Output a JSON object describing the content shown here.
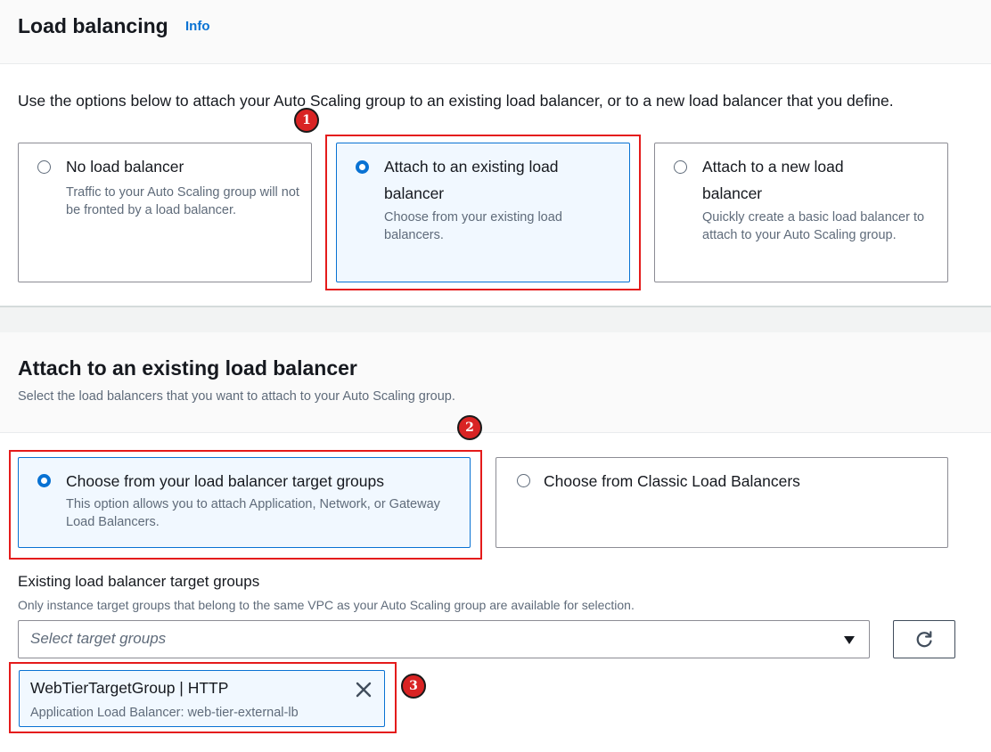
{
  "section1": {
    "title": "Load balancing",
    "info_link": "Info",
    "intro": "Use the options below to attach your Auto Scaling group to an existing load balancer, or to a new load balancer that you define."
  },
  "lb_options": [
    {
      "label": "No load balancer",
      "description": "Traffic to your Auto Scaling group will not be fronted by a load balancer.",
      "selected": false
    },
    {
      "label": "Attach to an existing load balancer",
      "description": "Choose from your existing load balancers.",
      "selected": true
    },
    {
      "label": "Attach to a new load balancer",
      "description": "Quickly create a basic load balancer to attach to your Auto Scaling group.",
      "selected": false
    }
  ],
  "section2": {
    "title": "Attach to an existing load balancer",
    "description": "Select the load balancers that you want to attach to your Auto Scaling group."
  },
  "source_options": [
    {
      "label": "Choose from your load balancer target groups",
      "description": "This option allows you to attach Application, Network, or Gateway Load Balancers.",
      "selected": true
    },
    {
      "label": "Choose from Classic Load Balancers",
      "description": "",
      "selected": false
    }
  ],
  "target_groups": {
    "label": "Existing load balancer target groups",
    "description": "Only instance target groups that belong to the same VPC as your Auto Scaling group are available for selection.",
    "placeholder": "Select target groups",
    "selected_token": {
      "title": "WebTierTargetGroup | HTTP",
      "subtitle": "Application Load Balancer: web-tier-external-lb"
    }
  },
  "annotations": [
    "1",
    "2",
    "3"
  ],
  "colors": {
    "accent": "#0972d3",
    "annotation_red": "#e41b1b"
  }
}
